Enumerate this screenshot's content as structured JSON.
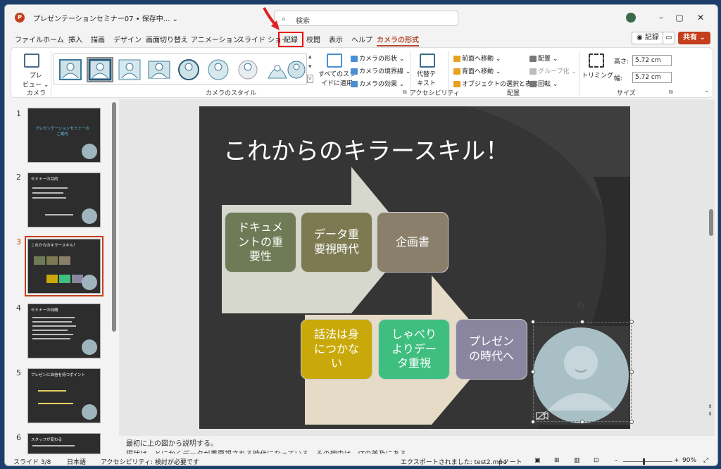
{
  "window": {
    "doc_title": "プレゼンテーションセミナー07 • 保存中... ⌄",
    "app_icon": "P"
  },
  "search": {
    "placeholder": "検索"
  },
  "menu": {
    "items": [
      "ファイル",
      "ホーム",
      "挿入",
      "描画",
      "デザイン",
      "画面切り替え",
      "アニメーション",
      "スライド ショー",
      "記録",
      "校閲",
      "表示",
      "ヘルプ",
      "カメラの形式"
    ],
    "record_btn": "◉ 記録",
    "share_btn": "共有 ⌄"
  },
  "ribbon": {
    "camera_label": "カメラ",
    "preview": "プレ\nビュー ⌄",
    "styles_label": "カメラのスタイル",
    "apply_all": "すべてのスラ\nイドに適用",
    "shape": "カメラの形状 ⌄",
    "border": "カメラの境界線 ⌄",
    "effect": "カメラの効果 ⌄",
    "alt_text": "代替テ\nキスト",
    "accessibility_label": "アクセシビリティ",
    "bring_forward": "前面へ移動 ⌄",
    "send_backward": "背面へ移動 ⌄",
    "selection_pane": "オブジェクトの選択と表示",
    "align": "配置 ⌄",
    "group": "グループ化 ⌄",
    "rotate": "回転 ⌄",
    "arrange_label": "配置",
    "trim": "トリミング",
    "height_label": "高さ:",
    "height_value": "5.72 cm",
    "width_label": "幅:",
    "width_value": "5.72 cm",
    "size_label": "サイズ"
  },
  "thumbs": [
    {
      "num": "1",
      "title": "プレゼンテーションセミナーの\nご案内"
    },
    {
      "num": "2",
      "title": "セミナーの目的"
    },
    {
      "num": "3",
      "title": "これからのキラースキル！"
    },
    {
      "num": "4",
      "title": "セミナーの特徴"
    },
    {
      "num": "5",
      "title": "プレゼンに自信を持つポイント"
    },
    {
      "num": "6",
      "title": "スタッフが変わる"
    }
  ],
  "slide": {
    "title": "これからのキラースキル！",
    "box1": "ドキュメ\nントの重\n要性",
    "box2": "データ重\n要視時代",
    "box3": "企画書",
    "box4": "話法は身\nにつかな\nい",
    "box5": "しゃべり\nよりデー\nタ重視",
    "box6": "プレゼン\nの時代へ",
    "colors": {
      "box1": "#6f7b56",
      "box2": "#7d7a52",
      "box3": "#8a7f6a",
      "box4": "#c9a90a",
      "box5": "#3fbf7f",
      "box6": "#8a86a0"
    }
  },
  "notes": {
    "line1": "最初に上の図から説明する。",
    "line2": "現状は、とにかくデータが重要視される時代になっている。その理由は、ITの普及にある"
  },
  "status": {
    "slide": "スライド 3/8",
    "lang": "日本語",
    "accessibility": "アクセシビリティ: 検討が必要です",
    "export": "エクスポートされました: test2.mp4",
    "notes_btn": "≜ノート",
    "zoom": "90%"
  }
}
